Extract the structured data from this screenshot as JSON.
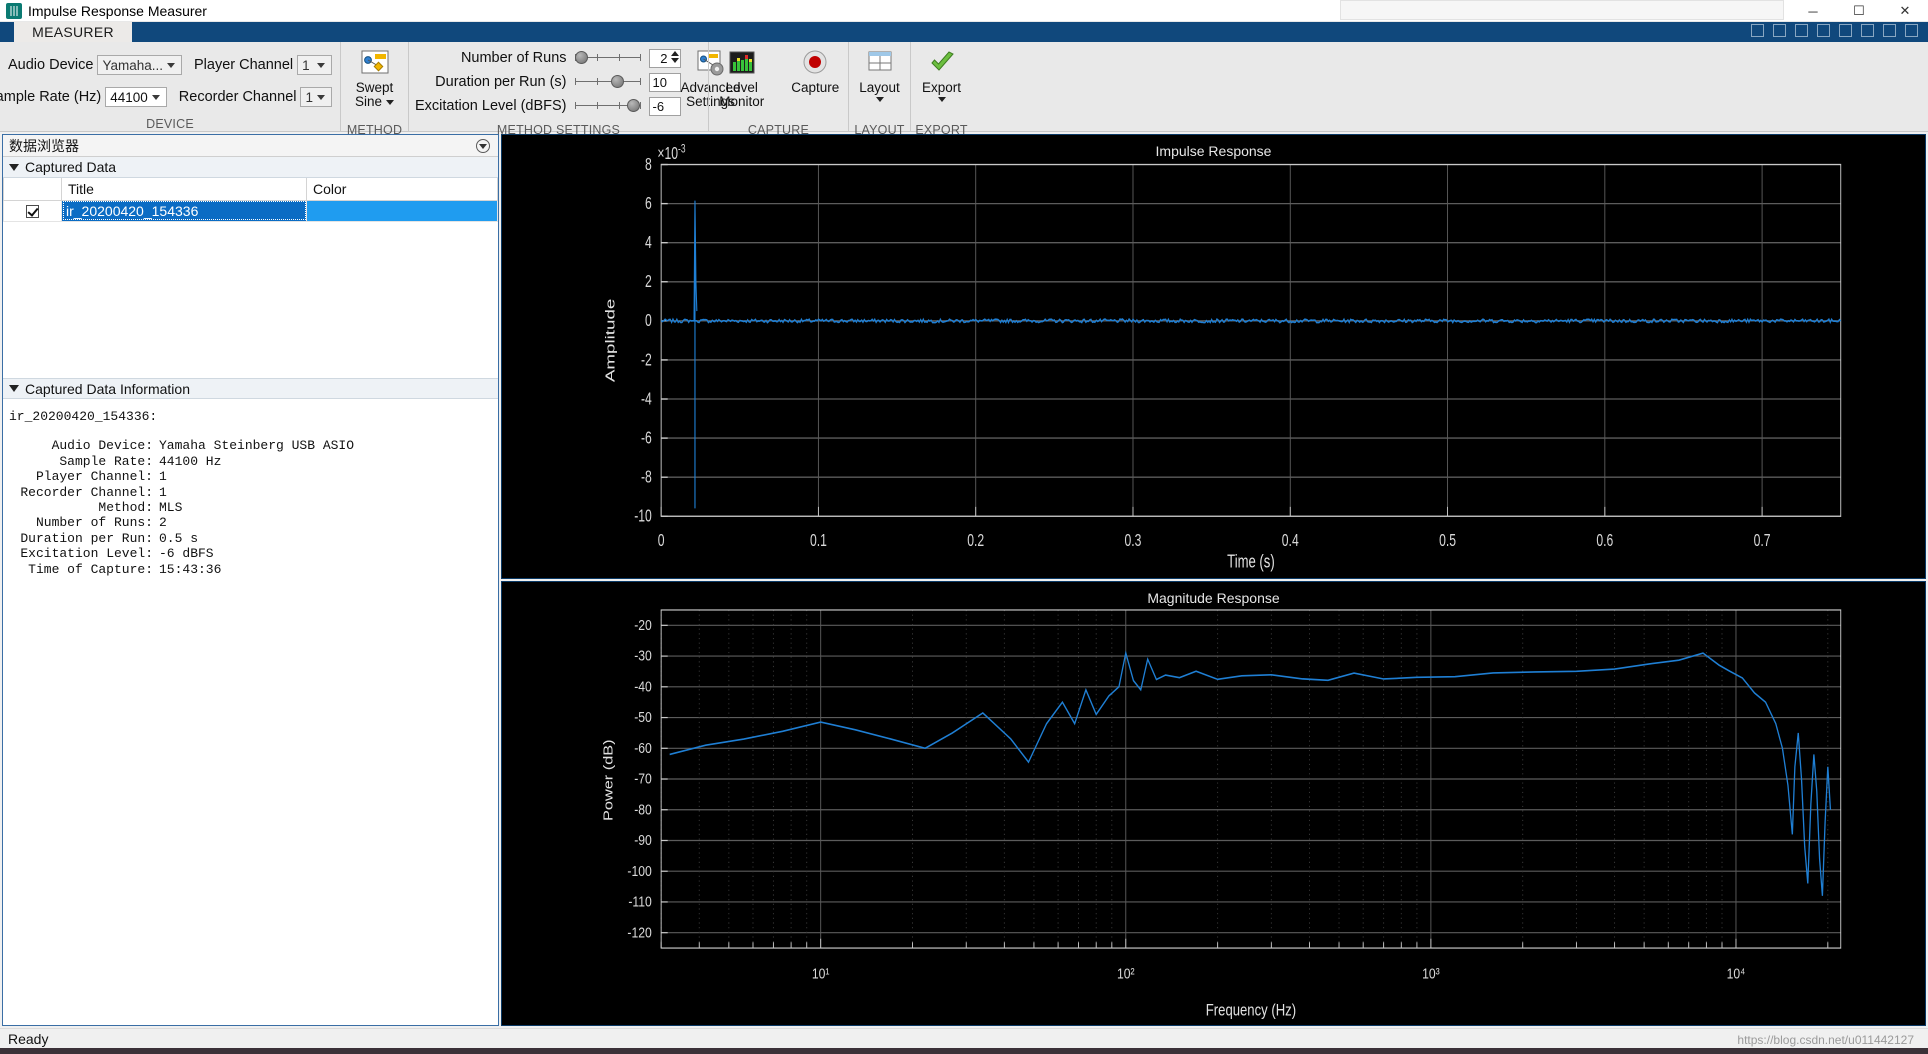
{
  "window": {
    "title": "Impulse Response Measurer",
    "icon": "app-icon",
    "minimize": "─",
    "maximize": "☐",
    "close": "✕"
  },
  "ribbon": {
    "tab": "MEASURER",
    "groups": {
      "device": {
        "label": "DEVICE",
        "audio_device_label": "Audio Device",
        "audio_device_value": "Yamaha...",
        "sample_rate_label": "Sample Rate (Hz)",
        "sample_rate_value": "44100",
        "player_channel_label": "Player Channel",
        "player_channel_value": "1",
        "recorder_channel_label": "Recorder Channel",
        "recorder_channel_value": "1"
      },
      "method": {
        "label": "METHOD",
        "button_line1": "Swept",
        "button_line2": "Sine",
        "icon": "swept-sine-icon"
      },
      "method_settings": {
        "label": "METHOD SETTINGS",
        "runs_label": "Number of Runs",
        "runs_value": "2",
        "runs_slider_pct": 6,
        "duration_label": "Duration per Run (s)",
        "duration_value": "10",
        "duration_slider_pct": 60,
        "excitation_label": "Excitation Level (dBFS)",
        "excitation_value": "-6",
        "excitation_slider_pct": 86,
        "advanced_line1": "Advanced",
        "advanced_line2": "Settings",
        "advanced_icon": "advanced-settings-icon"
      },
      "capture": {
        "label": "CAPTURE",
        "level_monitor_line1": "Level",
        "level_monitor_line2": "Monitor",
        "level_monitor_icon": "level-meter-icon",
        "capture_label": "Capture",
        "capture_icon": "record-icon"
      },
      "layout": {
        "label": "LAYOUT",
        "button": "Layout",
        "icon": "grid-layout-icon"
      },
      "export": {
        "label": "EXPORT",
        "button": "Export",
        "icon": "green-check-icon"
      }
    }
  },
  "browser": {
    "panel_title": "数据浏览器",
    "captured_data_section": "Captured Data",
    "columns": [
      "",
      "Title",
      "Color"
    ],
    "rows": [
      {
        "checked": true,
        "title": "ir_20200420_154336",
        "color": "#1f9cf0"
      }
    ],
    "info_section": "Captured Data Information",
    "info_title": "ir_20200420_154336:",
    "info": [
      {
        "key": "Audio Device:",
        "value": "Yamaha Steinberg USB ASIO"
      },
      {
        "key": "Sample Rate:",
        "value": "44100 Hz"
      },
      {
        "key": "Player Channel:",
        "value": "1"
      },
      {
        "key": "Recorder Channel:",
        "value": "1"
      },
      {
        "key": "Method:",
        "value": "MLS"
      },
      {
        "key": "Number of Runs:",
        "value": "2"
      },
      {
        "key": "Duration per Run:",
        "value": "0.5 s"
      },
      {
        "key": "Excitation Level:",
        "value": "-6 dBFS"
      },
      {
        "key": "Time of Capture:",
        "value": "15:43:36"
      }
    ]
  },
  "chart_data": [
    {
      "type": "line",
      "title": "Impulse Response",
      "xlabel": "Time (s)",
      "ylabel": "Amplitude",
      "y_exponent": "×10",
      "y_exponent_sup": "-3",
      "xlim": [
        0,
        0.75
      ],
      "ylim": [
        -10,
        8
      ],
      "xticks": [
        0,
        0.1,
        0.2,
        0.3,
        0.4,
        0.5,
        0.6,
        0.7
      ],
      "xticklabels": [
        "0",
        "0.1",
        "0.2",
        "0.3",
        "0.4",
        "0.5",
        "0.6",
        "0.7"
      ],
      "yticks": [
        -10,
        -8,
        -6,
        -4,
        -2,
        0,
        2,
        4,
        6,
        8
      ],
      "yticklabels": [
        "-10",
        "-8",
        "-6",
        "-4",
        "-2",
        "0",
        "2",
        "4",
        "6",
        "8"
      ],
      "grid": true,
      "series_color": "#1f7fd4",
      "impulse_time": 0.0215,
      "peak_value": 6.15,
      "trough_value": -9.6,
      "baseline": 0,
      "note": "Near-zero baseline with a single sharp bipolar impulse just after t=0"
    },
    {
      "type": "line",
      "title": "Magnitude Response",
      "xlabel": "Frequency (Hz)",
      "ylabel": "Power (dB)",
      "xscale": "log",
      "xlim": [
        3,
        22050
      ],
      "ylim": [
        -125,
        -15
      ],
      "xticks": [
        10,
        100,
        1000,
        10000
      ],
      "xticklabels": [
        "10¹",
        "10²",
        "10³",
        "10⁴"
      ],
      "yticks": [
        -20,
        -30,
        -40,
        -50,
        -60,
        -70,
        -80,
        -90,
        -100,
        -110,
        -120
      ],
      "yticklabels": [
        "-20",
        "-30",
        "-40",
        "-50",
        "-60",
        "-70",
        "-80",
        "-90",
        "-100",
        "-110",
        "-120"
      ],
      "grid": true,
      "series_color": "#1f7fd4",
      "points": [
        [
          3.2,
          -62
        ],
        [
          4.2,
          -59
        ],
        [
          5.6,
          -57
        ],
        [
          7.5,
          -54.5
        ],
        [
          10,
          -51.5
        ],
        [
          13,
          -54
        ],
        [
          17,
          -57
        ],
        [
          22,
          -60
        ],
        [
          27,
          -55
        ],
        [
          34,
          -48.5
        ],
        [
          42,
          -57
        ],
        [
          48,
          -64.5
        ],
        [
          55,
          -52
        ],
        [
          62,
          -45
        ],
        [
          68,
          -52
        ],
        [
          74,
          -41
        ],
        [
          80,
          -49
        ],
        [
          88,
          -43
        ],
        [
          95,
          -40
        ],
        [
          100,
          -29
        ],
        [
          106,
          -38
        ],
        [
          112,
          -41
        ],
        [
          118,
          -31
        ],
        [
          126,
          -38
        ],
        [
          135,
          -36
        ],
        [
          150,
          -37
        ],
        [
          170,
          -36
        ],
        [
          200,
          -37
        ],
        [
          240,
          -36.5
        ],
        [
          300,
          -37
        ],
        [
          380,
          -36.5
        ],
        [
          460,
          -37
        ],
        [
          560,
          -36.5
        ],
        [
          700,
          -37
        ],
        [
          900,
          -36.5
        ],
        [
          1200,
          -37
        ],
        [
          1600,
          -36
        ],
        [
          2200,
          -34.5
        ],
        [
          3000,
          -35
        ],
        [
          4000,
          -34
        ],
        [
          5200,
          -32
        ],
        [
          6500,
          -31.5
        ],
        [
          7800,
          -30
        ],
        [
          8800,
          -33
        ],
        [
          9500,
          -35
        ],
        [
          10500,
          -38
        ],
        [
          11500,
          -41
        ],
        [
          12500,
          -45
        ],
        [
          13500,
          -52
        ],
        [
          14200,
          -60
        ],
        [
          14800,
          -72
        ],
        [
          15300,
          -88
        ],
        [
          15600,
          -66
        ],
        [
          16000,
          -55
        ],
        [
          16400,
          -70
        ],
        [
          16800,
          -92
        ],
        [
          17200,
          -104
        ],
        [
          17600,
          -78
        ],
        [
          18000,
          -62
        ],
        [
          18400,
          -74
        ],
        [
          18800,
          -96
        ],
        [
          19200,
          -108
        ],
        [
          19600,
          -84
        ],
        [
          20000,
          -66
        ],
        [
          20400,
          -80
        ]
      ],
      "note": "Broadband response flat near -36 dB mid-band, rolling off steeply above 12 kHz"
    }
  ],
  "status": {
    "text": "Ready"
  },
  "watermark": "https://blog.csdn.net/u011442127"
}
